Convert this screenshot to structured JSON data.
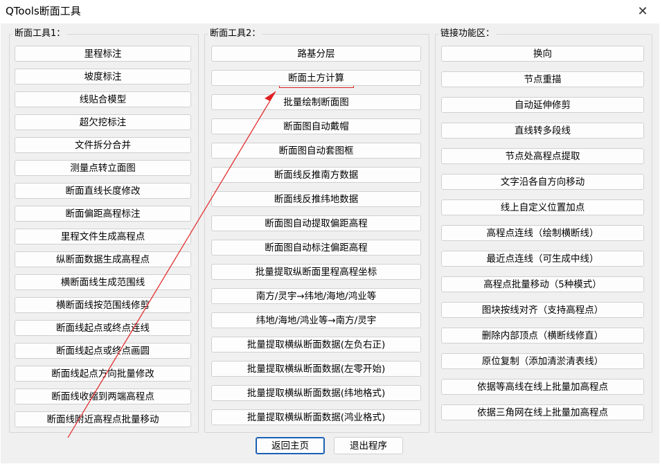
{
  "window": {
    "title": "QTools断面工具",
    "close_glyph": "✕"
  },
  "group1": {
    "label": "断面工具1：",
    "buttons": [
      "里程标注",
      "坡度标注",
      "线贴合模型",
      "超欠挖标注",
      "文件拆分合并",
      "测量点转立面图",
      "断面直线长度修改",
      "断面偏距高程标注",
      "里程文件生成高程点",
      "纵断面数据生成高程点",
      "横断面线生成范围线",
      "横断面线按范围线修剪",
      "断面线起点或终点连线",
      "断面线起点或终点画圆",
      "断面线起点方向批量修改",
      "断面线收缩到两端高程点",
      "断面线附近高程点批量移动"
    ]
  },
  "group2": {
    "label": "断面工具2：",
    "buttons": [
      "路基分层",
      "断面土方计算",
      "批量绘制断面图",
      "断面图自动戴帽",
      "断面图自动套图框",
      "断面线反推南方数据",
      "断面线反推纬地数据",
      "断面图自动提取偏距高程",
      "断面图自动标注偏距高程",
      "批量提取纵断面里程高程坐标",
      "南方/灵宇→纬地/海地/鸿业等",
      "纬地/海地/鸿业等→南方/灵宇",
      "批量提取横纵断面数据(左负右正)",
      "批量提取横纵断面数据(左零开始)",
      "批量提取横纵断面数据(纬地格式)",
      "批量提取横纵断面数据(鸿业格式)"
    ]
  },
  "group3": {
    "label": "链接功能区：",
    "buttons": [
      "换向",
      "节点重描",
      "自动延伸修剪",
      "直线转多段线",
      "节点处高程点提取",
      "文字沿各自方向移动",
      "线上自定义位置加点",
      "高程点连线（绘制横断线）",
      "最近点连线（可生成中线）",
      "高程点批量移动（5种模式）",
      "图块按线对齐（支持高程点）",
      "删除内部顶点（横断线修直）",
      "原位复制（添加清淤清表线）",
      "依据等高线在线上批量加高程点",
      "依据三角网在线上批量加高程点"
    ]
  },
  "bottom": {
    "home_label": "返回主页",
    "exit_label": "退出程序"
  },
  "annotation": {
    "color": "#e02020"
  }
}
